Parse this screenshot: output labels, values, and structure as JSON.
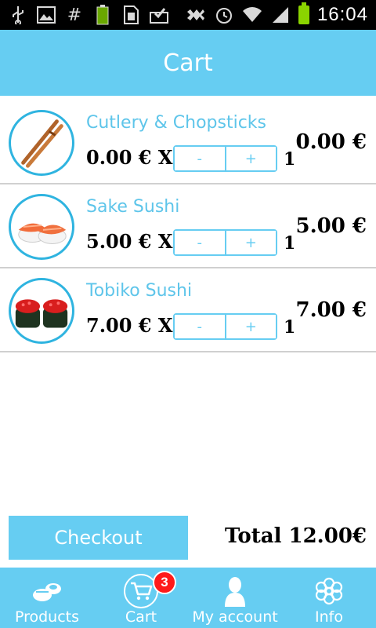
{
  "status_bar": {
    "time": "16:04",
    "icons": [
      "usb-icon",
      "image-icon",
      "hash-icon",
      "battery-100-icon",
      "sim-icon",
      "download-check-icon",
      "mute-icon",
      "alarm-icon",
      "wifi-icon",
      "signal-icon",
      "battery-icon"
    ],
    "battery_label": "100%"
  },
  "header": {
    "title": "Cart"
  },
  "cart": {
    "items": [
      {
        "name": "Cutlery & Chopsticks",
        "unit_price": "0.00 € X",
        "minus_label": "-",
        "plus_label": "+",
        "quantity": "1",
        "line_total": "0.00 €",
        "image": "chopsticks"
      },
      {
        "name": "Sake Sushi",
        "unit_price": "5.00 € X",
        "minus_label": "-",
        "plus_label": "+",
        "quantity": "1",
        "line_total": "5.00 €",
        "image": "sake-sushi"
      },
      {
        "name": "Tobiko Sushi",
        "unit_price": "7.00 € X",
        "minus_label": "-",
        "plus_label": "+",
        "quantity": "1",
        "line_total": "7.00 €",
        "image": "tobiko-sushi"
      }
    ],
    "checkout_label": "Checkout",
    "total_label": "Total 12.00€"
  },
  "nav": {
    "items": [
      {
        "label": "Products",
        "icon": "sushi-icon"
      },
      {
        "label": "Cart",
        "icon": "cart-icon",
        "badge": "3"
      },
      {
        "label": "My account",
        "icon": "user-icon"
      },
      {
        "label": "Info",
        "icon": "info-flower-icon"
      }
    ]
  },
  "colors": {
    "accent": "#66cdf2",
    "accent_dark": "#2fb4e0",
    "badge": "#ff1a1a",
    "text": "#000000"
  }
}
